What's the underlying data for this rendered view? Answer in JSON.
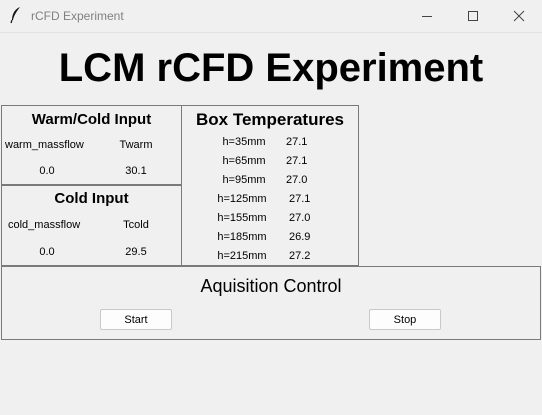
{
  "window": {
    "title": "rCFD Experiment"
  },
  "main_title": "LCM rCFD Experiment",
  "warm_cold_input": {
    "title": "Warm/Cold Input",
    "col1_header": "warm_massflow",
    "col2_header": "Twarm",
    "col1_value": "0.0",
    "col2_value": "30.1"
  },
  "cold_input": {
    "title": "Cold Input",
    "col1_header": "cold_massflow",
    "col2_header": "Tcold",
    "col1_value": "0.0",
    "col2_value": "29.5"
  },
  "box_temperatures": {
    "title": "Box Temperatures",
    "rows": [
      {
        "label": "h=35mm",
        "value": "27.1"
      },
      {
        "label": "h=65mm",
        "value": "27.1"
      },
      {
        "label": "h=95mm",
        "value": "27.0"
      },
      {
        "label": "h=125mm",
        "value": "27.1"
      },
      {
        "label": "h=155mm",
        "value": "27.0"
      },
      {
        "label": "h=185mm",
        "value": "26.9"
      },
      {
        "label": "h=215mm",
        "value": "27.2"
      }
    ]
  },
  "acquisition_control": {
    "title": "Aquisition Control",
    "start_label": "Start",
    "stop_label": "Stop"
  },
  "icons": {
    "app": "feather-icon",
    "minimize": "minimize-icon",
    "maximize": "maximize-icon",
    "close": "close-icon"
  }
}
